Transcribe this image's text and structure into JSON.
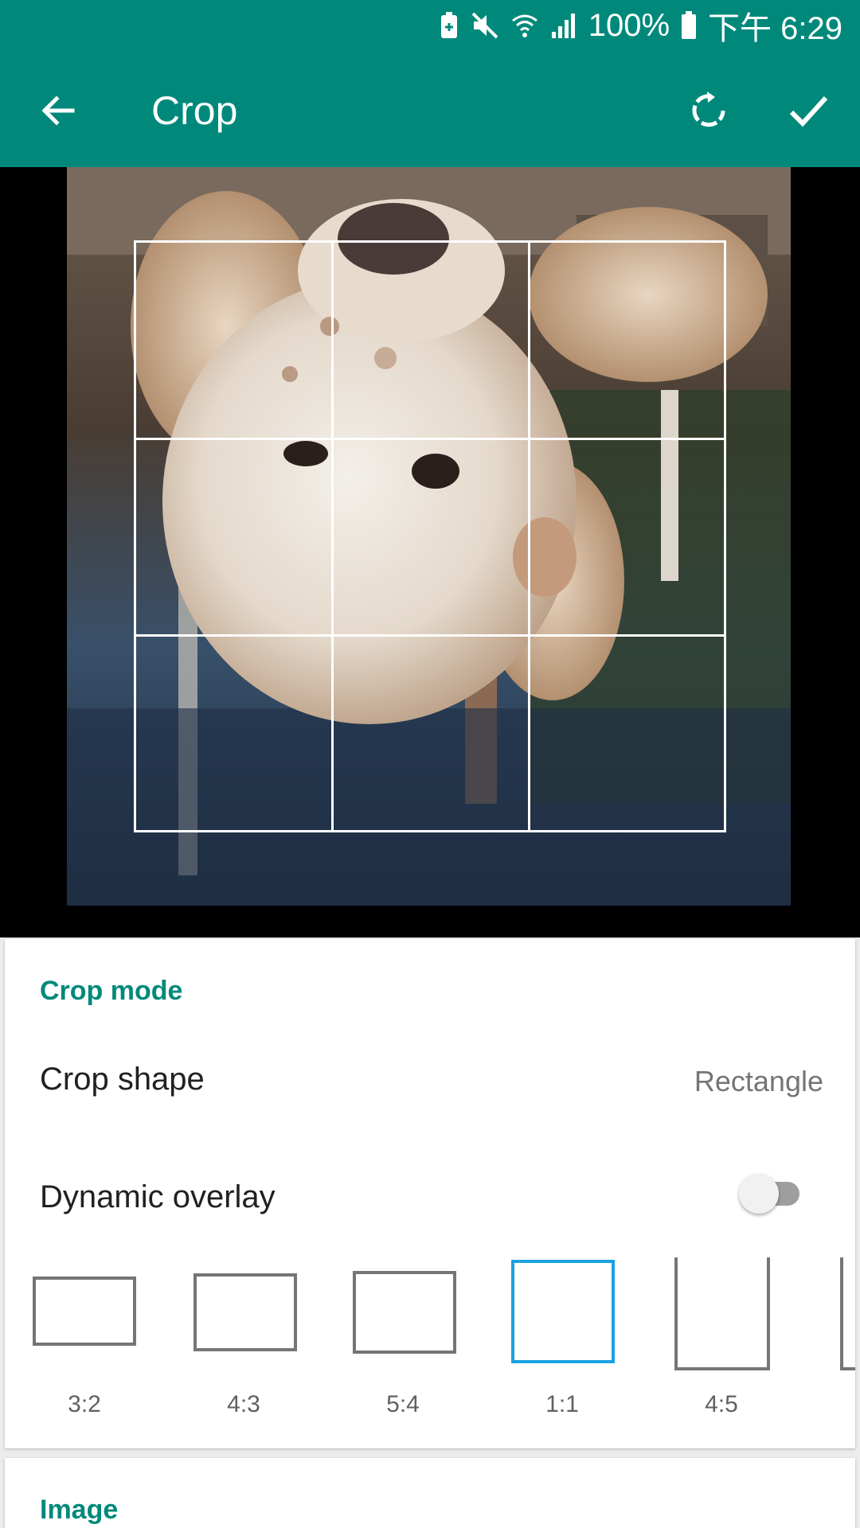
{
  "status_bar": {
    "battery": "100%",
    "time": "下午 6:29"
  },
  "app_bar": {
    "title": "Crop"
  },
  "crop_mode": {
    "header": "Crop mode",
    "crop_shape_label": "Crop shape",
    "crop_shape_value": "Rectangle",
    "dynamic_overlay_label": "Dynamic overlay",
    "dynamic_overlay_enabled": false
  },
  "aspect_ratios": [
    {
      "label": "3:2",
      "selected": false
    },
    {
      "label": "4:3",
      "selected": false
    },
    {
      "label": "5:4",
      "selected": false
    },
    {
      "label": "1:1",
      "selected": true
    },
    {
      "label": "4:5",
      "selected": false
    }
  ],
  "image_section": {
    "header": "Image"
  },
  "colors": {
    "primary": "#00897b",
    "selected_ratio": "#1ba1e2"
  }
}
